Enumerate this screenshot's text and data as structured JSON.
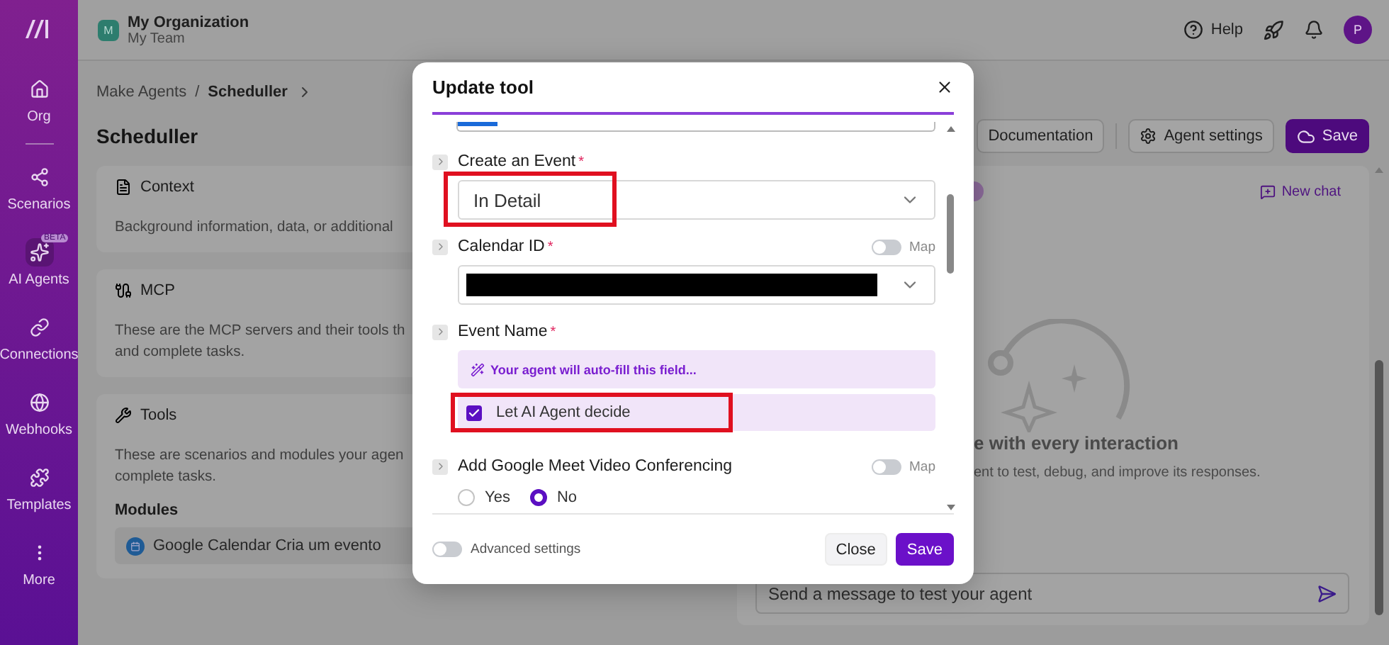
{
  "sidebar": {
    "items": [
      {
        "label": "Org",
        "selected": false
      },
      {
        "label": "Scenarios",
        "selected": false
      },
      {
        "label": "AI Agents",
        "badge": "BETA",
        "selected": true
      },
      {
        "label": "Connections",
        "selected": false
      },
      {
        "label": "Webhooks",
        "selected": false
      },
      {
        "label": "Templates",
        "selected": false
      },
      {
        "label": "More",
        "selected": false
      }
    ]
  },
  "header": {
    "org_initial": "M",
    "org_name": "My Organization",
    "team": "My Team",
    "help": "Help",
    "user_initial": "P"
  },
  "breadcrumb": {
    "items": [
      "Make Agents",
      "Scheduller"
    ],
    "separator": "/"
  },
  "page_title": "Scheduller",
  "actions": [
    {
      "label": "Documentation",
      "kind": "outline"
    },
    {
      "label": "Agent settings",
      "kind": "settings"
    },
    {
      "label": "Save",
      "kind": "primary"
    }
  ],
  "sections": [
    {
      "title": "Context",
      "lines": [
        "Background information, data, or additional"
      ]
    },
    {
      "title": "MCP",
      "lines": [
        "These are the MCP servers and their tools th",
        "and complete tasks."
      ]
    },
    {
      "title": "Tools",
      "lines": [
        "These are scenarios and modules your agen",
        "complete tasks."
      ],
      "subheading": "Modules",
      "modules": [
        "Google Calendar Cria um evento"
      ]
    }
  ],
  "chat": {
    "new_chat": "New chat",
    "title": "e with every interaction",
    "subtitle": "ent to test, debug, and improve its responses.",
    "input": {
      "placeholder": "Send a message to test your agent"
    }
  },
  "dialog": {
    "title": "Update tool",
    "fields": [
      {
        "kind": "select",
        "label": "Create an Event",
        "mark": "*",
        "value": "In Detail",
        "annotated": true
      },
      {
        "kind": "select",
        "label": "Calendar ID",
        "mark": "*",
        "map": {
          "label": "Map",
          "on": false
        },
        "redacted": true
      },
      {
        "kind": "ai",
        "label": "Event Name",
        "mark": "*",
        "notice": "Your agent will auto-fill this field...",
        "checkbox": {
          "label": "Let AI Agent decide",
          "checked": true,
          "annotated": true
        }
      },
      {
        "kind": "radio",
        "label": "Add Google Meet Video Conferencing",
        "map": {
          "label": "Map",
          "on": false
        },
        "options": [
          {
            "label": "Yes",
            "selected": false
          },
          {
            "label": "No",
            "selected": true
          }
        ]
      }
    ],
    "advanced": {
      "label": "Advanced settings",
      "on": false
    },
    "buttons": [
      {
        "label": "Close",
        "kind": "secondary"
      },
      {
        "label": "Save",
        "kind": "primary"
      }
    ]
  }
}
